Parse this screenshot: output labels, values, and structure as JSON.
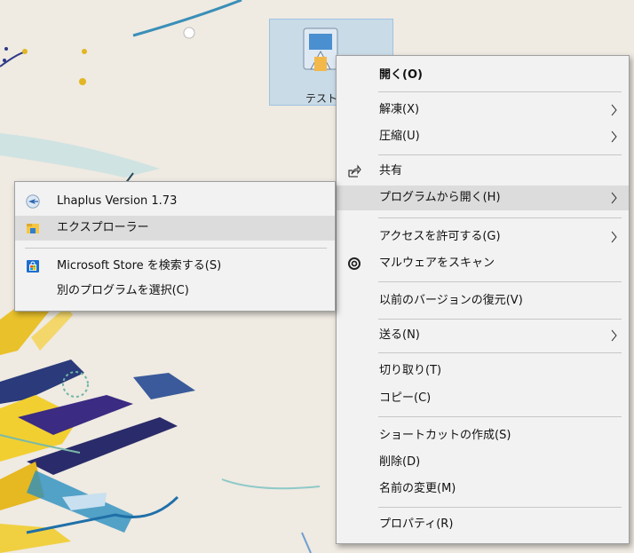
{
  "desktop": {
    "icon_label": "テスト"
  },
  "context_menu": {
    "items": [
      {
        "label": "開く(O)",
        "bold": true
      },
      {
        "label": "解凍(X)",
        "submenu": true
      },
      {
        "label": "圧縮(U)",
        "submenu": true
      },
      {
        "label": "共有",
        "icon": "share-icon"
      },
      {
        "label": "プログラムから開く(H)",
        "submenu": true,
        "highlighted": true
      },
      {
        "label": "アクセスを許可する(G)",
        "submenu": true
      },
      {
        "label": "マルウェアをスキャン",
        "icon": "antivirus-scan-icon"
      },
      {
        "label": "以前のバージョンの復元(V)"
      },
      {
        "label": "送る(N)",
        "submenu": true
      },
      {
        "label": "切り取り(T)"
      },
      {
        "label": "コピー(C)"
      },
      {
        "label": "ショートカットの作成(S)"
      },
      {
        "label": "削除(D)"
      },
      {
        "label": "名前の変更(M)"
      },
      {
        "label": "プロパティ(R)"
      }
    ]
  },
  "open_with_submenu": {
    "items": [
      {
        "label": "Lhaplus Version 1.73",
        "icon": "lhaplus-icon"
      },
      {
        "label": "エクスプローラー",
        "icon": "explorer-folder-icon",
        "highlighted": true
      },
      {
        "label": "Microsoft Store を検索する(S)",
        "icon": "microsoft-store-icon"
      },
      {
        "label": "別のプログラムを選択(C)"
      }
    ]
  },
  "colors": {
    "menu_background": "#f2f2f2",
    "highlight": "#dcdcdc",
    "separator": "#c7c7c7",
    "selection_blue": "#aacdeb"
  }
}
